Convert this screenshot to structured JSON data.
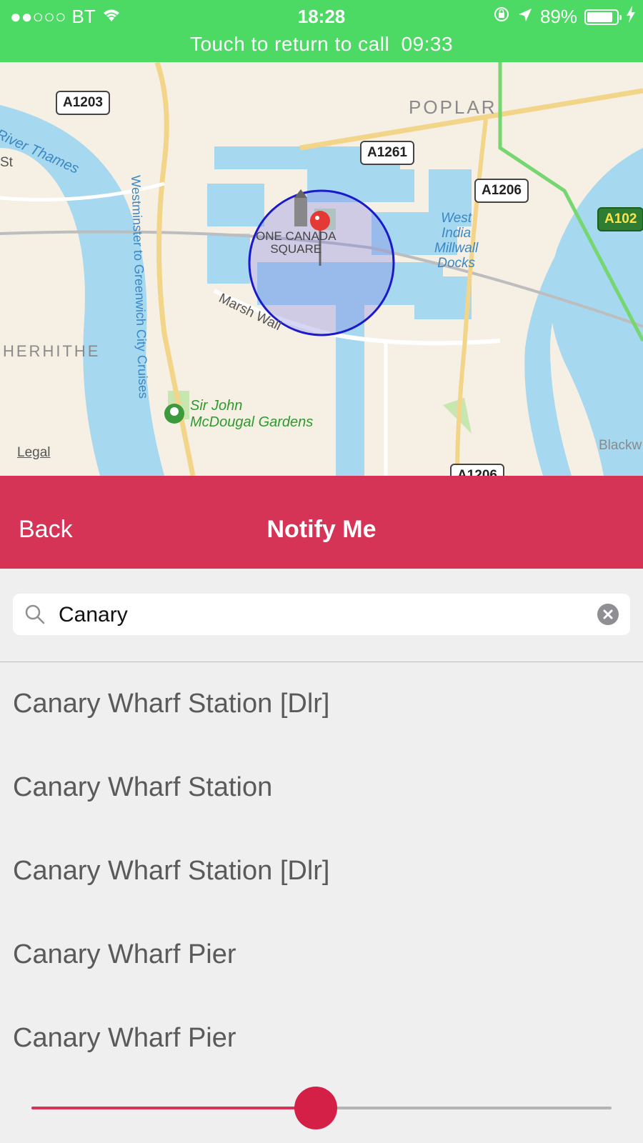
{
  "status_bar": {
    "signal": "●●○○○",
    "carrier": "BT",
    "time": "18:28",
    "battery_percent_label": "89%",
    "battery_level": 0.89,
    "call_banner_text": "Touch to return to call",
    "call_duration": "09:33"
  },
  "map": {
    "labels": {
      "a1203": "A1203",
      "a1261": "A1261",
      "a1206_top": "A1206",
      "a1206_bottom": "A1206",
      "a102": "A102",
      "poplar": "POPLAR",
      "river_thames": "River Thames",
      "westminster": "Westminster to Greenwich City Cruises",
      "west_india_line1": "West",
      "west_india_line2": "India",
      "west_india_line3": "Millwall",
      "west_india_line4": "Docks",
      "one_canada_line1": "ONE CANADA",
      "one_canada_line2": "SQUARE",
      "marsh_wall": "Marsh Wall",
      "rotherhithe": "HERHITHE",
      "gardens_line1": "Sir John",
      "gardens_line2": "McDougal Gardens",
      "blackwall": "Blackw",
      "st": "St",
      "legal": "Legal"
    },
    "colors": {
      "water": "#a6d8f0",
      "land": "#f5efe4",
      "park": "#c8e6b0",
      "radius_circle": "#1a1acc"
    }
  },
  "nav": {
    "back_label": "Back",
    "title": "Notify Me",
    "accent": "#d63456"
  },
  "search": {
    "value": "Canary",
    "placeholder": ""
  },
  "results": [
    "Canary Wharf Station  [Dlr]",
    "Canary Wharf Station",
    "Canary Wharf Station [Dlr]",
    "Canary Wharf Pier",
    "Canary Wharf Pier"
  ],
  "slider": {
    "value": 0.49
  }
}
